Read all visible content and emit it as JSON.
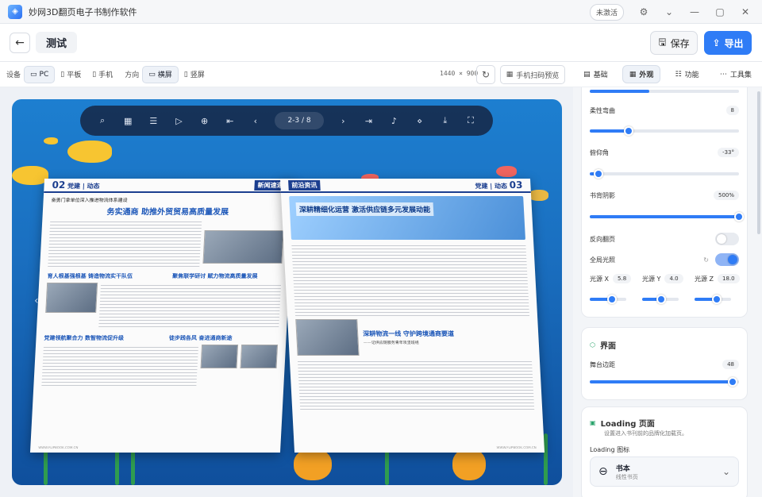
{
  "app": {
    "title": "妙网3D翻页电子书制作软件",
    "activate": "未激活",
    "logo": "mw"
  },
  "topbar": {
    "project_title": "测试",
    "save": "保存",
    "export": "导出"
  },
  "device": {
    "label": "设备",
    "options": [
      "PC",
      "平板",
      "手机"
    ],
    "selected": "PC",
    "orientation_label": "方向",
    "orientations": [
      "横屏",
      "竖屏"
    ],
    "selected_orientation": "横屏",
    "resolution": "1440 × 900",
    "qr_preview": "手机扫码预览"
  },
  "viewer": {
    "page_indicator": "2-3 / 8"
  },
  "book": {
    "left": {
      "header_num": "02",
      "header_text": "党建 | 动态",
      "header_tag": "新闻速递",
      "kicker": "奋勇门拿单位深入推进物流体系建设",
      "title": "务实通商 助推外贸贸易高质量发展",
      "h2": "育人根基强根基 铸造物流实干队伍",
      "h3": "聚焦联学研讨 赋力物流高质量发展",
      "h4": "党建领航聚合力 数智物流促升级",
      "h5": "徒步践各风 奋进通商新途",
      "footer": "WWW.FLIPBOOK.COM.CN"
    },
    "right": {
      "header_num": "03",
      "header_text": "党建 | 动态",
      "header_tag": "前沿资讯",
      "hero": "深耕精细化运营 激活供应链多元发展动能",
      "h2": "深耕物流一线 守护跨境通商要道",
      "h2sub": "——记供应链服务青年攻坚班组",
      "footer": "WWW.FLIPBOOK.COM.CN"
    }
  },
  "side_tabs": [
    "基础",
    "外观",
    "功能",
    "工具集"
  ],
  "side_active": "外观",
  "settings": {
    "flex_label": "柔性弯曲",
    "flex_value": "8",
    "flex": 0.26,
    "pitch_label": "俯仰角",
    "pitch_value": "-33°",
    "pitch": 0.06,
    "shadow_label": "书背阴影",
    "shadow_value": "500%",
    "shadow": 1.0,
    "reverse_label": "反向翻页",
    "global_light_label": "全局光照",
    "lx_label": "光源 X",
    "lx_value": "5.8",
    "ly_label": "光源 Y",
    "ly_value": "4.0",
    "lz_label": "光源 Z",
    "lz_value": "18.0",
    "interface_title": "界面",
    "margin_label": "舞台边距",
    "margin_value": "48",
    "margin": 0.96,
    "loading_title": "Loading 页面",
    "loading_desc": "设置进入书刊前的品牌化加载页。",
    "loading_icon_label": "Loading 图标",
    "loading_option": "书本",
    "loading_option_sub": "线性书页"
  }
}
